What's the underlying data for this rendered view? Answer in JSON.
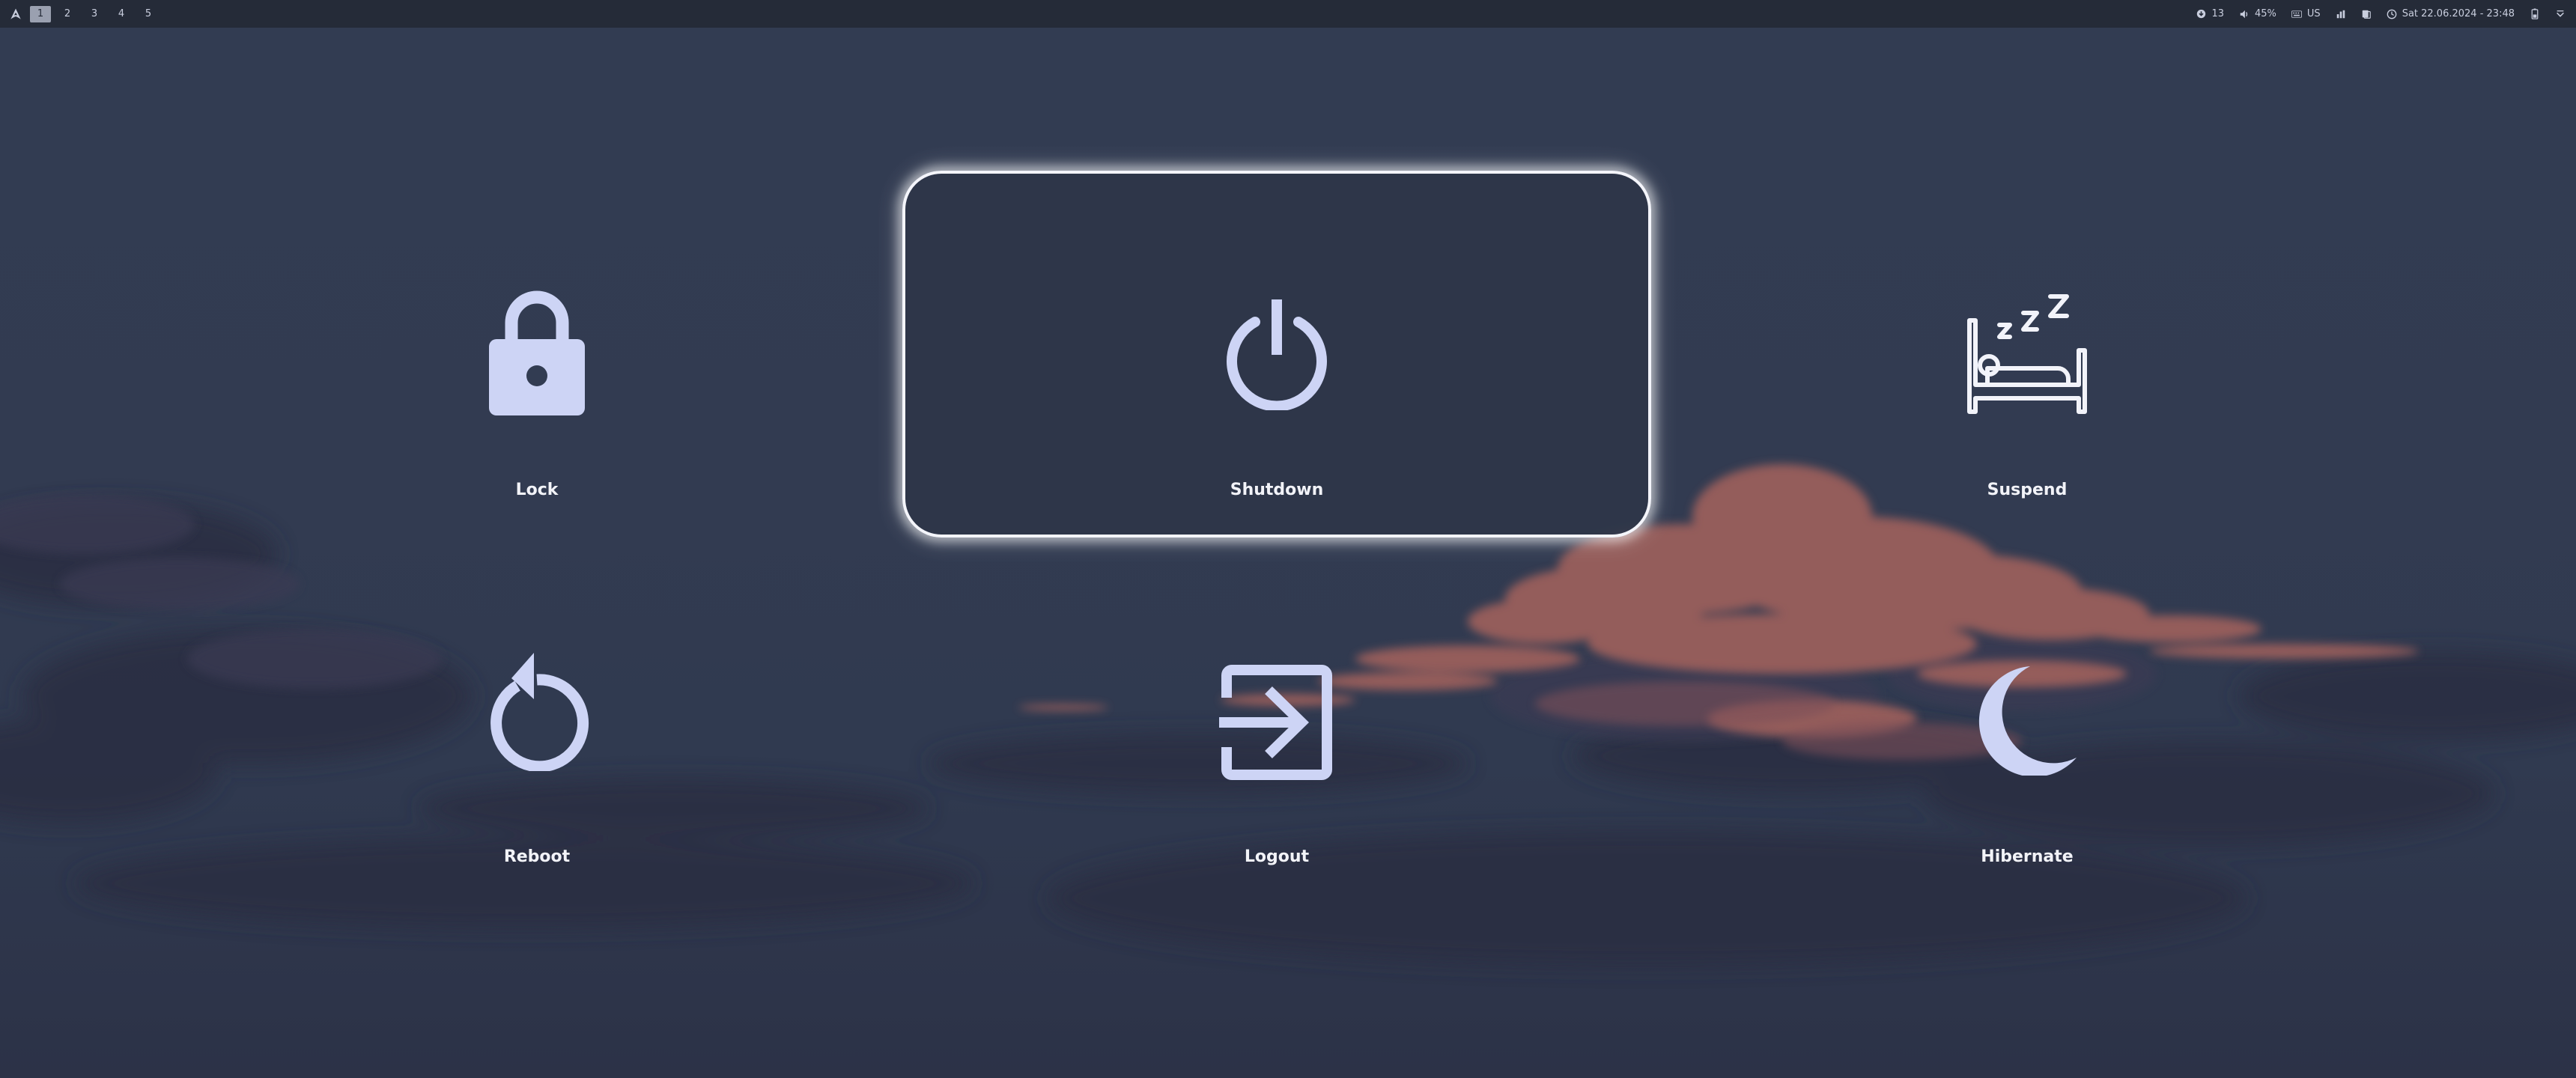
{
  "topbar": {
    "workspaces": [
      "1",
      "2",
      "3",
      "4",
      "5"
    ],
    "active_workspace": "1",
    "tray": {
      "updates": "13",
      "volume": "45%",
      "keyboard_layout": "US",
      "datetime": "Sat 22.06.2024 - 23:48"
    }
  },
  "menu": {
    "lock": "Lock",
    "shutdown": "Shutdown",
    "suspend": "Suspend",
    "reboot": "Reboot",
    "logout": "Logout",
    "hibernate": "Hibernate",
    "selected": "shutdown"
  },
  "colors": {
    "icon": "#cdd4f5",
    "topbar_bg": "#252b38",
    "background": "#323c52",
    "cloud": "#a0625f",
    "selection_border": "#f4f5fb"
  }
}
